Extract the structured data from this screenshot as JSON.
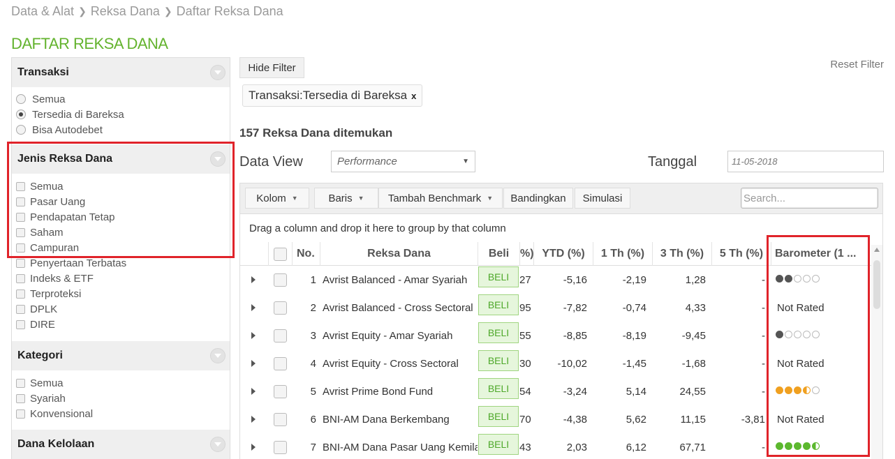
{
  "breadcrumb": [
    "Data & Alat",
    "Reksa Dana",
    "Daftar Reksa Dana"
  ],
  "page_title": "DAFTAR REKSA DANA",
  "sidebar": {
    "transaksi": {
      "title": "Transaksi",
      "options": [
        {
          "label": "Semua",
          "selected": false
        },
        {
          "label": "Tersedia di Bareksa",
          "selected": true
        },
        {
          "label": "Bisa Autodebet",
          "selected": false
        }
      ]
    },
    "jenis": {
      "title": "Jenis Reksa Dana",
      "options": [
        "Semua",
        "Pasar Uang",
        "Pendapatan Tetap",
        "Saham",
        "Campuran",
        "Penyertaan Terbatas",
        "Indeks & ETF",
        "Terproteksi",
        "DPLK",
        "DIRE"
      ]
    },
    "kategori": {
      "title": "Kategori",
      "options": [
        "Semua",
        "Syariah",
        "Konvensional"
      ]
    },
    "dana_kelolaan": {
      "title": "Dana Kelolaan"
    }
  },
  "filter": {
    "hide_label": "Hide Filter",
    "reset_label": "Reset Filter",
    "chip_label": "Transaksi:Tersedia di Bareksa",
    "chip_close": "x"
  },
  "result_count": "157 Reksa Dana ditemukan",
  "data_view": {
    "label": "Data View",
    "value": "Performance"
  },
  "tanggal": {
    "label": "Tanggal",
    "value": "11-05-2018"
  },
  "toolbar": {
    "kolom": "Kolom",
    "baris": "Baris",
    "benchmark": "Tambah Benchmark",
    "bandingkan": "Bandingkan",
    "simulasi": "Simulasi",
    "search_placeholder": "Search..."
  },
  "group_hint": "Drag a column and drop it here to group by that column",
  "table": {
    "headers": {
      "no": "No.",
      "name": "Reksa Dana",
      "beli": "Beli",
      "partial": "%)",
      "ytd": "YTD (%)",
      "th1": "1 Th (%)",
      "th3": "3 Th (%)",
      "th5": "5 Th (%)",
      "barometer": "Barometer (1 ..."
    },
    "beli_label": "BELI",
    "rows": [
      {
        "no": "1",
        "name": "Avrist Balanced - Amar Syariah",
        "partial": "27",
        "ytd": "-5,16",
        "th1": "-2,19",
        "th3": "1,28",
        "th5": "-",
        "barometer": {
          "rated": true,
          "rating": 2,
          "color": "#555555"
        }
      },
      {
        "no": "2",
        "name": "Avrist Balanced - Cross Sectoral",
        "partial": "95",
        "ytd": "-7,82",
        "th1": "-0,74",
        "th3": "4,33",
        "th5": "-",
        "barometer": {
          "rated": false,
          "text": "Not Rated"
        }
      },
      {
        "no": "3",
        "name": "Avrist Equity - Amar Syariah",
        "partial": "55",
        "ytd": "-8,85",
        "th1": "-8,19",
        "th3": "-9,45",
        "th5": "-",
        "barometer": {
          "rated": true,
          "rating": 1,
          "color": "#555555"
        }
      },
      {
        "no": "4",
        "name": "Avrist Equity - Cross Sectoral",
        "partial": "30",
        "ytd": "-10,02",
        "th1": "-1,45",
        "th3": "-1,68",
        "th5": "-",
        "barometer": {
          "rated": false,
          "text": "Not Rated"
        }
      },
      {
        "no": "5",
        "name": "Avrist Prime Bond Fund",
        "partial": "54",
        "ytd": "-3,24",
        "th1": "5,14",
        "th3": "24,55",
        "th5": "-",
        "barometer": {
          "rated": true,
          "rating": 3.5,
          "color": "#f0a020"
        }
      },
      {
        "no": "6",
        "name": "BNI-AM Dana Berkembang",
        "partial": "70",
        "ytd": "-4,38",
        "th1": "5,62",
        "th3": "11,15",
        "th5": "-3,81",
        "barometer": {
          "rated": false,
          "text": "Not Rated"
        }
      },
      {
        "no": "7",
        "name": "BNI-AM Dana Pasar Uang Kemila",
        "partial": "43",
        "ytd": "2,03",
        "th1": "6,12",
        "th3": "67,71",
        "th5": "-",
        "barometer": {
          "rated": true,
          "rating": 4.5,
          "color": "#5cb82e"
        }
      }
    ]
  }
}
